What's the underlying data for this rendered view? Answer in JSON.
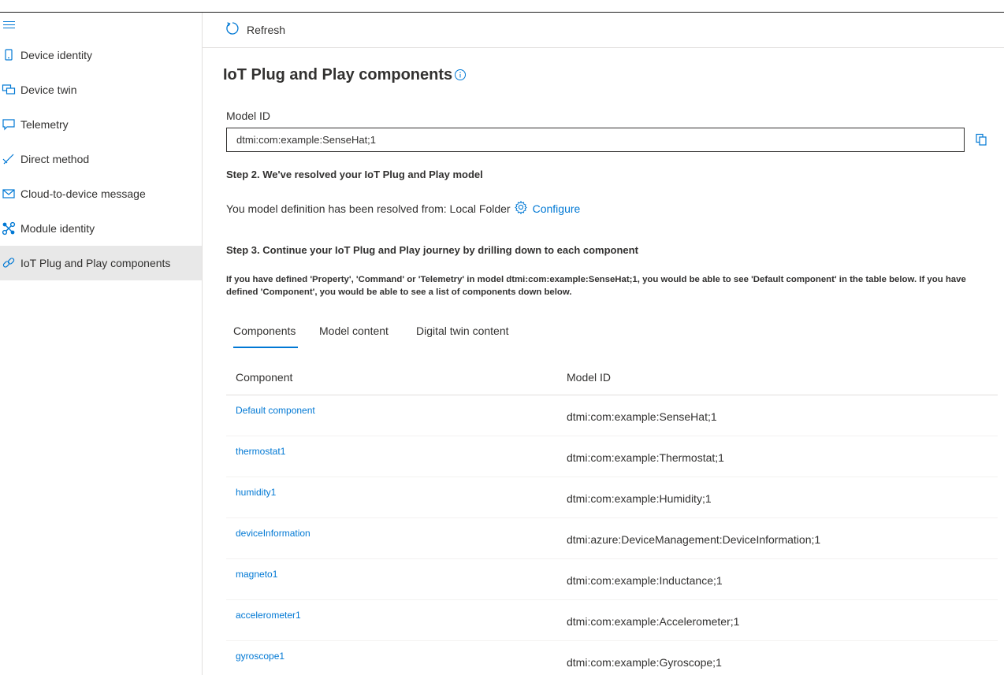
{
  "sidebar": {
    "items": [
      {
        "label": "Device identity",
        "icon": "device-icon"
      },
      {
        "label": "Device twin",
        "icon": "twin-icon"
      },
      {
        "label": "Telemetry",
        "icon": "chat-icon"
      },
      {
        "label": "Direct method",
        "icon": "method-icon"
      },
      {
        "label": "Cloud-to-device message",
        "icon": "mail-icon"
      },
      {
        "label": "Module identity",
        "icon": "module-icon"
      },
      {
        "label": "IoT Plug and Play components",
        "icon": "link-icon",
        "active": true
      }
    ]
  },
  "toolbar": {
    "refresh_label": "Refresh"
  },
  "page": {
    "title": "IoT Plug and Play components",
    "model_id_label": "Model ID",
    "model_id_value": "dtmi:com:example:SenseHat;1",
    "step2_heading": "Step 2. We've resolved your IoT Plug and Play model",
    "resolved_text": "You model definition has been resolved from: Local Folder",
    "configure_label": "Configure",
    "step3_heading": "Step 3. Continue your IoT Plug and Play journey by drilling down to each component",
    "description": "If you have defined 'Property', 'Command' or 'Telemetry' in model dtmi:com:example:SenseHat;1, you would be able to see 'Default component' in the table below. If you have defined 'Component', you would be able to see a list of components down below."
  },
  "tabs": [
    {
      "label": "Components",
      "selected": true
    },
    {
      "label": "Model content"
    },
    {
      "label": "Digital twin content"
    }
  ],
  "table": {
    "headers": [
      "Component",
      "Model ID"
    ],
    "rows": [
      {
        "component": "Default component",
        "model_id": "dtmi:com:example:SenseHat;1"
      },
      {
        "component": "thermostat1",
        "model_id": "dtmi:com:example:Thermostat;1"
      },
      {
        "component": "humidity1",
        "model_id": "dtmi:com:example:Humidity;1"
      },
      {
        "component": "deviceInformation",
        "model_id": "dtmi:azure:DeviceManagement:DeviceInformation;1"
      },
      {
        "component": "magneto1",
        "model_id": "dtmi:com:example:Inductance;1"
      },
      {
        "component": "accelerometer1",
        "model_id": "dtmi:com:example:Accelerometer;1"
      },
      {
        "component": "gyroscope1",
        "model_id": "dtmi:com:example:Gyroscope;1"
      }
    ]
  },
  "colors": {
    "accent": "#0078d4",
    "text": "#323130",
    "active_bg": "#e8e8e8"
  }
}
